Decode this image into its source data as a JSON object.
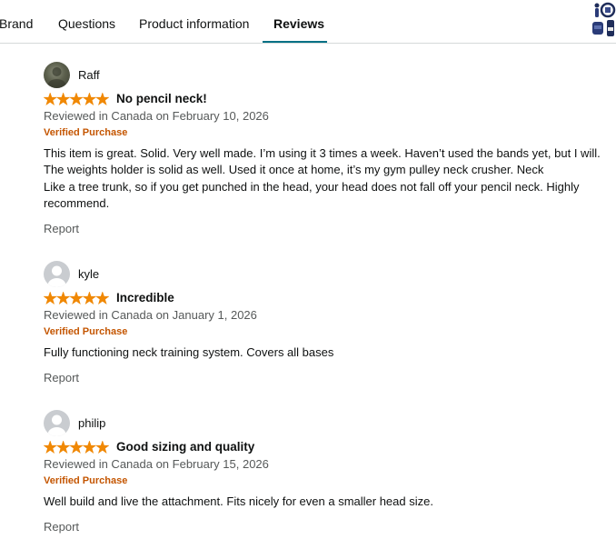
{
  "tabs": [
    {
      "label": "Brand"
    },
    {
      "label": "Questions"
    },
    {
      "label": "Product information"
    },
    {
      "label": "Reviews"
    }
  ],
  "active_tab": "Reviews",
  "colors": {
    "star": "#f08804",
    "verified": "#c45500",
    "tab_accent": "#007185",
    "meta_text": "#565959"
  },
  "reviews": [
    {
      "author": "Raff",
      "avatar": "photo",
      "rating": 5,
      "title": "No pencil neck!",
      "meta": "Reviewed in Canada on February 10, 2026",
      "verified": "Verified Purchase",
      "body_lines": [
        "This item is great. Solid. Very well made. I’m using it 3 times a week. Haven’t used the bands yet, but I will.",
        "The weights holder is solid as well. Used it once at home, it’s my gym pulley neck crusher. Neck",
        "Like a tree trunk, so if you get punched in the head, your head does not fall off your pencil neck. Highly",
        "recommend."
      ],
      "report": "Report"
    },
    {
      "author": "kyle",
      "avatar": "default",
      "rating": 5,
      "title": "Incredible",
      "meta": "Reviewed in Canada on January 1, 2026",
      "verified": "Verified Purchase",
      "body_lines": [
        "Fully functioning neck training system. Covers all bases"
      ],
      "report": "Report"
    },
    {
      "author": "philip",
      "avatar": "default",
      "rating": 5,
      "title": "Good sizing and quality",
      "meta": "Reviewed in Canada on February 15, 2026",
      "verified": "Verified Purchase",
      "body_lines": [
        "Well build and live the attachment. Fits nicely for even a smaller head size."
      ],
      "report": "Report"
    }
  ]
}
